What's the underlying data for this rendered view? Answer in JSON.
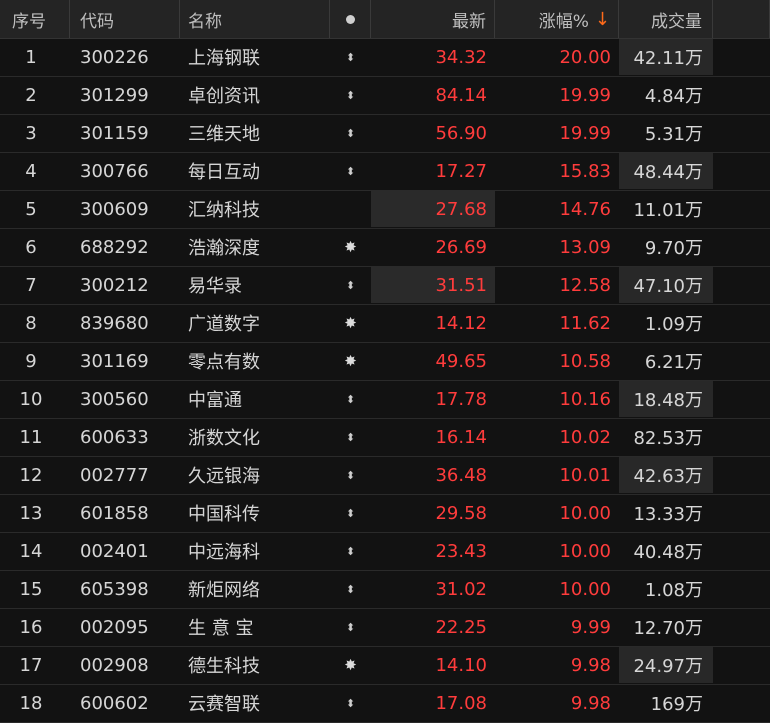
{
  "header": {
    "idx": "序号",
    "code": "代码",
    "name": "名称",
    "price": "最新",
    "pct": "涨幅%",
    "sort_arrow": "↓",
    "vol": "成交量"
  },
  "rows": [
    {
      "idx": "1",
      "code": "300226",
      "name": "上海钢联",
      "icon": "updown-arrow-icon",
      "price": "34.32",
      "pct": "20.00",
      "vol": "42.11万",
      "hl_price": false,
      "hl_vol": true
    },
    {
      "idx": "2",
      "code": "301299",
      "name": "卓创资讯",
      "icon": "updown-arrow-icon",
      "price": "84.14",
      "pct": "19.99",
      "vol": "4.84万",
      "hl_price": false,
      "hl_vol": false
    },
    {
      "idx": "3",
      "code": "301159",
      "name": "三维天地",
      "icon": "updown-arrow-icon",
      "price": "56.90",
      "pct": "19.99",
      "vol": "5.31万",
      "hl_price": false,
      "hl_vol": false
    },
    {
      "idx": "4",
      "code": "300766",
      "name": "每日互动",
      "icon": "updown-arrow-icon",
      "price": "17.27",
      "pct": "15.83",
      "vol": "48.44万",
      "hl_price": false,
      "hl_vol": true
    },
    {
      "idx": "5",
      "code": "300609",
      "name": "汇纳科技",
      "icon": "none",
      "price": "27.68",
      "pct": "14.76",
      "vol": "11.01万",
      "hl_price": true,
      "hl_vol": false
    },
    {
      "idx": "6",
      "code": "688292",
      "name": "浩瀚深度",
      "icon": "star-burst-icon",
      "price": "26.69",
      "pct": "13.09",
      "vol": "9.70万",
      "hl_price": false,
      "hl_vol": false
    },
    {
      "idx": "7",
      "code": "300212",
      "name": "易华录",
      "icon": "updown-arrow-icon",
      "price": "31.51",
      "pct": "12.58",
      "vol": "47.10万",
      "hl_price": true,
      "hl_vol": true
    },
    {
      "idx": "8",
      "code": "839680",
      "name": "广道数字",
      "icon": "star-burst-icon",
      "price": "14.12",
      "pct": "11.62",
      "vol": "1.09万",
      "hl_price": false,
      "hl_vol": false
    },
    {
      "idx": "9",
      "code": "301169",
      "name": "零点有数",
      "icon": "star-burst-icon",
      "price": "49.65",
      "pct": "10.58",
      "vol": "6.21万",
      "hl_price": false,
      "hl_vol": false
    },
    {
      "idx": "10",
      "code": "300560",
      "name": "中富通",
      "icon": "updown-arrow-icon",
      "price": "17.78",
      "pct": "10.16",
      "vol": "18.48万",
      "hl_price": false,
      "hl_vol": true
    },
    {
      "idx": "11",
      "code": "600633",
      "name": "浙数文化",
      "icon": "updown-arrow-icon",
      "price": "16.14",
      "pct": "10.02",
      "vol": "82.53万",
      "hl_price": false,
      "hl_vol": false
    },
    {
      "idx": "12",
      "code": "002777",
      "name": "久远银海",
      "icon": "updown-arrow-icon",
      "price": "36.48",
      "pct": "10.01",
      "vol": "42.63万",
      "hl_price": false,
      "hl_vol": true
    },
    {
      "idx": "13",
      "code": "601858",
      "name": "中国科传",
      "icon": "updown-arrow-icon",
      "price": "29.58",
      "pct": "10.00",
      "vol": "13.33万",
      "hl_price": false,
      "hl_vol": false
    },
    {
      "idx": "14",
      "code": "002401",
      "name": "中远海科",
      "icon": "updown-arrow-icon",
      "price": "23.43",
      "pct": "10.00",
      "vol": "40.48万",
      "hl_price": false,
      "hl_vol": false
    },
    {
      "idx": "15",
      "code": "605398",
      "name": "新炬网络",
      "icon": "updown-arrow-icon",
      "price": "31.02",
      "pct": "10.00",
      "vol": "1.08万",
      "hl_price": false,
      "hl_vol": false
    },
    {
      "idx": "16",
      "code": "002095",
      "name": "生 意 宝",
      "icon": "updown-arrow-icon",
      "price": "22.25",
      "pct": "9.99",
      "vol": "12.70万",
      "hl_price": false,
      "hl_vol": false
    },
    {
      "idx": "17",
      "code": "002908",
      "name": "德生科技",
      "icon": "star-burst-icon",
      "price": "14.10",
      "pct": "9.98",
      "vol": "24.97万",
      "hl_price": false,
      "hl_vol": true
    },
    {
      "idx": "18",
      "code": "600602",
      "name": "云赛智联",
      "icon": "updown-arrow-icon",
      "price": "17.08",
      "pct": "9.98",
      "vol": "169万",
      "hl_price": false,
      "hl_vol": false
    }
  ]
}
